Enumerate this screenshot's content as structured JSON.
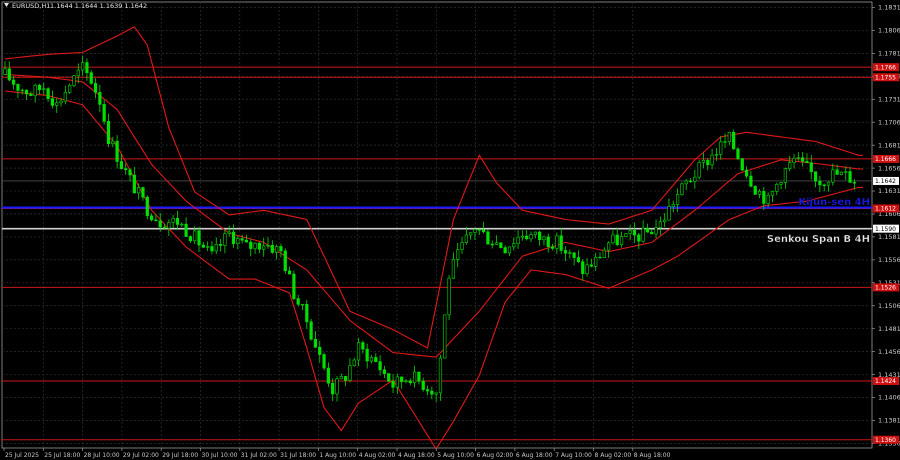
{
  "header": {
    "symbol": "EURUSD,H1",
    "quote": "1.1644 1.1644 1.1639 1.1642"
  },
  "colors": {
    "background": "#000000",
    "grid": "#2f2f2f",
    "bull": "#00e000",
    "bear": "#00e000",
    "bands": "#e01818",
    "level": "#cc1818",
    "kijun": "#1a1aff",
    "senkou": "#d0d0d0"
  },
  "chart_data": {
    "type": "candlestick",
    "ylim": [
      1.1351,
      1.1837
    ],
    "yticks": [
      "1.1831",
      "1.1806",
      "1.1781",
      "1.1756",
      "1.1731",
      "1.1706",
      "1.1681",
      "1.1656",
      "1.1631",
      "1.1606",
      "1.1581",
      "1.1556",
      "1.1531",
      "1.1506",
      "1.1481",
      "1.1456",
      "1.1431",
      "1.1406",
      "1.1381",
      "1.1356"
    ],
    "xticks": [
      "25 Jul 2025",
      "25 Jul 18:00",
      "28 Jul 10:00",
      "29 Jul 02:00",
      "29 Jul 18:00",
      "30 Jul 10:00",
      "31 Jul 02:00",
      "31 Jul 18:00",
      "1 Aug 10:00",
      "4 Aug 02:00",
      "4 Aug 18:00",
      "5 Aug 10:00",
      "6 Aug 02:00",
      "6 Aug 18:00",
      "7 Aug 10:00",
      "8 Aug 02:00",
      "8 Aug 18:00"
    ],
    "current_price": "1.1642",
    "levels": [
      {
        "price": 1.1766,
        "label": "1.1766",
        "kind": "level"
      },
      {
        "price": 1.1755,
        "label": "1.1755",
        "kind": "level"
      },
      {
        "price": 1.1666,
        "label": "1.1666",
        "kind": "level"
      },
      {
        "price": 1.1612,
        "label": "1.1612",
        "kind": "level"
      },
      {
        "price": 1.1526,
        "label": "1.1526",
        "kind": "level"
      },
      {
        "price": 1.1424,
        "label": "1.1424",
        "kind": "level"
      },
      {
        "price": 1.136,
        "label": "1.1360",
        "kind": "level"
      },
      {
        "price": 1.1613,
        "label": "",
        "kind": "kijun"
      },
      {
        "price": 1.159,
        "label": "1.1590",
        "kind": "senkou"
      }
    ],
    "annotations": [
      {
        "text": "Kijun-sen 4H",
        "price": 1.162,
        "color": "#1a1aff"
      },
      {
        "text": "Senkou Span B 4H",
        "price": 1.158,
        "color": "#e6e6e6"
      }
    ],
    "close_path": [
      [
        0,
        1.1758
      ],
      [
        3,
        1.1745
      ],
      [
        6,
        1.1738
      ],
      [
        9,
        1.1745
      ],
      [
        12,
        1.1725
      ],
      [
        15,
        1.1748
      ],
      [
        18,
        1.1765
      ],
      [
        20,
        1.1752
      ],
      [
        22,
        1.173
      ],
      [
        24,
        1.169
      ],
      [
        27,
        1.166
      ],
      [
        30,
        1.1635
      ],
      [
        33,
        1.1612
      ],
      [
        36,
        1.1598
      ],
      [
        40,
        1.1598
      ],
      [
        44,
        1.158
      ],
      [
        48,
        1.156
      ],
      [
        52,
        1.1585
      ],
      [
        56,
        1.157
      ],
      [
        60,
        1.1575
      ],
      [
        64,
        1.1565
      ],
      [
        67,
        1.152
      ],
      [
        70,
        1.149
      ],
      [
        73,
        1.145
      ],
      [
        76,
        1.1415
      ],
      [
        79,
        1.143
      ],
      [
        82,
        1.146
      ],
      [
        86,
        1.1445
      ],
      [
        90,
        1.142
      ],
      [
        94,
        1.143
      ],
      [
        98,
        1.1418
      ],
      [
        100,
        1.1412
      ],
      [
        101,
        1.145
      ],
      [
        103,
        1.154
      ],
      [
        106,
        1.157
      ],
      [
        109,
        1.1592
      ],
      [
        112,
        1.158
      ],
      [
        116,
        1.157
      ],
      [
        120,
        1.1585
      ],
      [
        124,
        1.158
      ],
      [
        128,
        1.1575
      ],
      [
        131,
        1.156
      ],
      [
        134,
        1.1545
      ],
      [
        137,
        1.1555
      ],
      [
        140,
        1.1575
      ],
      [
        144,
        1.158
      ],
      [
        148,
        1.1583
      ],
      [
        152,
        1.1595
      ],
      [
        155,
        1.162
      ],
      [
        158,
        1.164
      ],
      [
        162,
        1.166
      ],
      [
        166,
        1.168
      ],
      [
        168,
        1.1688
      ],
      [
        171,
        1.166
      ],
      [
        174,
        1.1635
      ],
      [
        177,
        1.162
      ],
      [
        180,
        1.1648
      ],
      [
        183,
        1.1665
      ],
      [
        186,
        1.1655
      ],
      [
        189,
        1.1642
      ],
      [
        192,
        1.165
      ],
      [
        195,
        1.1648
      ],
      [
        198,
        1.1642
      ]
    ],
    "bands": {
      "upper": [
        [
          0,
          1.1775
        ],
        [
          10,
          1.178
        ],
        [
          18,
          1.1782
        ],
        [
          26,
          1.18
        ],
        [
          30,
          1.181
        ],
        [
          33,
          1.179
        ],
        [
          38,
          1.17
        ],
        [
          44,
          1.163
        ],
        [
          52,
          1.1605
        ],
        [
          60,
          1.161
        ],
        [
          70,
          1.16
        ],
        [
          74,
          1.156
        ],
        [
          80,
          1.15
        ],
        [
          90,
          1.148
        ],
        [
          98,
          1.146
        ],
        [
          104,
          1.16
        ],
        [
          110,
          1.167
        ],
        [
          114,
          1.164
        ],
        [
          120,
          1.161
        ],
        [
          130,
          1.16
        ],
        [
          140,
          1.1595
        ],
        [
          150,
          1.161
        ],
        [
          160,
          1.1665
        ],
        [
          166,
          1.169
        ],
        [
          172,
          1.1695
        ],
        [
          180,
          1.169
        ],
        [
          188,
          1.1685
        ],
        [
          198,
          1.167
        ]
      ],
      "middle": [
        [
          0,
          1.1758
        ],
        [
          10,
          1.1755
        ],
        [
          18,
          1.175
        ],
        [
          26,
          1.172
        ],
        [
          34,
          1.166
        ],
        [
          42,
          1.162
        ],
        [
          52,
          1.1585
        ],
        [
          60,
          1.1575
        ],
        [
          70,
          1.1545
        ],
        [
          80,
          1.149
        ],
        [
          90,
          1.1455
        ],
        [
          100,
          1.145
        ],
        [
          110,
          1.15
        ],
        [
          120,
          1.156
        ],
        [
          130,
          1.1575
        ],
        [
          140,
          1.1565
        ],
        [
          150,
          1.1575
        ],
        [
          160,
          1.161
        ],
        [
          170,
          1.165
        ],
        [
          180,
          1.1665
        ],
        [
          190,
          1.166
        ],
        [
          198,
          1.1655
        ]
      ],
      "lower": [
        [
          0,
          1.174
        ],
        [
          10,
          1.1735
        ],
        [
          18,
          1.1725
        ],
        [
          26,
          1.168
        ],
        [
          34,
          1.161
        ],
        [
          42,
          1.157
        ],
        [
          52,
          1.1535
        ],
        [
          58,
          1.1535
        ],
        [
          66,
          1.152
        ],
        [
          70,
          1.146
        ],
        [
          74,
          1.1395
        ],
        [
          78,
          1.137
        ],
        [
          82,
          1.14
        ],
        [
          90,
          1.1425
        ],
        [
          96,
          1.138
        ],
        [
          100,
          1.135
        ],
        [
          104,
          1.138
        ],
        [
          110,
          1.143
        ],
        [
          116,
          1.151
        ],
        [
          122,
          1.1545
        ],
        [
          130,
          1.154
        ],
        [
          140,
          1.1525
        ],
        [
          150,
          1.1545
        ],
        [
          156,
          1.156
        ],
        [
          162,
          1.158
        ],
        [
          168,
          1.16
        ],
        [
          176,
          1.1615
        ],
        [
          186,
          1.162
        ],
        [
          198,
          1.1635
        ]
      ]
    }
  }
}
